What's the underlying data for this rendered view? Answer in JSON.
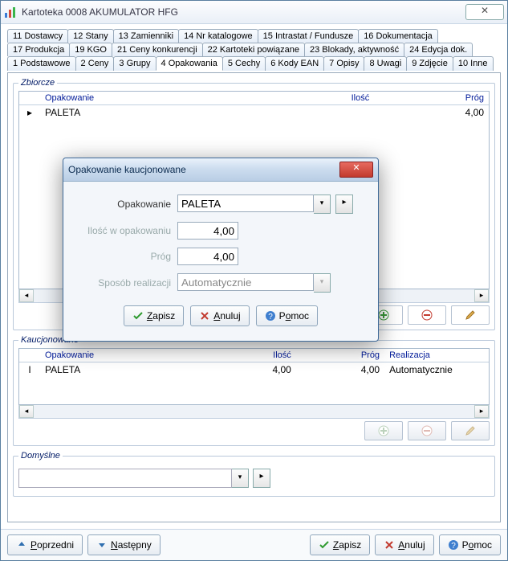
{
  "window": {
    "title": "Kartoteka  0008  AKUMULATOR HFG",
    "close_glyph": "✕"
  },
  "tabs_rows": [
    [
      "11 Dostawcy",
      "12 Stany",
      "13 Zamienniki",
      "14 Nr katalogowe",
      "15 Intrastat / Fundusze",
      "16 Dokumentacja"
    ],
    [
      "17 Produkcja",
      "19 KGO",
      "21 Ceny konkurencji",
      "22 Kartoteki powiązane",
      "23 Blokady, aktywność",
      "24 Edycja dok."
    ],
    [
      "1 Podstawowe",
      "2 Ceny",
      "3 Grupy",
      "4 Opakowania",
      "5 Cechy",
      "6 Kody EAN",
      "7 Opisy",
      "8 Uwagi",
      "9 Zdjęcie",
      "10 Inne"
    ]
  ],
  "active_tab": "4 Opakowania",
  "zbiorcze": {
    "legend": "Zbiorcze",
    "headers": {
      "op": "Opakowanie",
      "il": "Ilość",
      "pr": "Próg"
    },
    "rows": [
      {
        "op": "PALETA",
        "il": "",
        "pr": "4,00"
      }
    ]
  },
  "kaucjonowane": {
    "legend": "Kaucjonowane",
    "headers": {
      "op": "Opakowanie",
      "il": "Ilość",
      "pr": "Próg",
      "re": "Realizacja"
    },
    "rows": [
      {
        "op": "PALETA",
        "il": "4,00",
        "pr": "4,00",
        "re": "Automatycznie"
      }
    ]
  },
  "domyslne": {
    "legend": "Domyślne",
    "value": ""
  },
  "modal": {
    "title": "Opakowanie kaucjonowane",
    "labels": {
      "opakowanie": "Opakowanie",
      "ilosc": "Ilość w opakowaniu",
      "prog": "Próg",
      "sposob": "Sposób realizacji"
    },
    "values": {
      "opakowanie": "PALETA",
      "ilosc": "4,00",
      "prog": "4,00",
      "sposob": "Automatycznie"
    },
    "buttons": {
      "zapisz": "Zapisz",
      "anuluj": "Anuluj",
      "pomoc": "Pomoc"
    }
  },
  "footer": {
    "poprzedni": "Poprzedni",
    "nastepny": "Następny",
    "zapisz": "Zapisz",
    "anuluj": "Anuluj",
    "pomoc": "Pomoc"
  }
}
